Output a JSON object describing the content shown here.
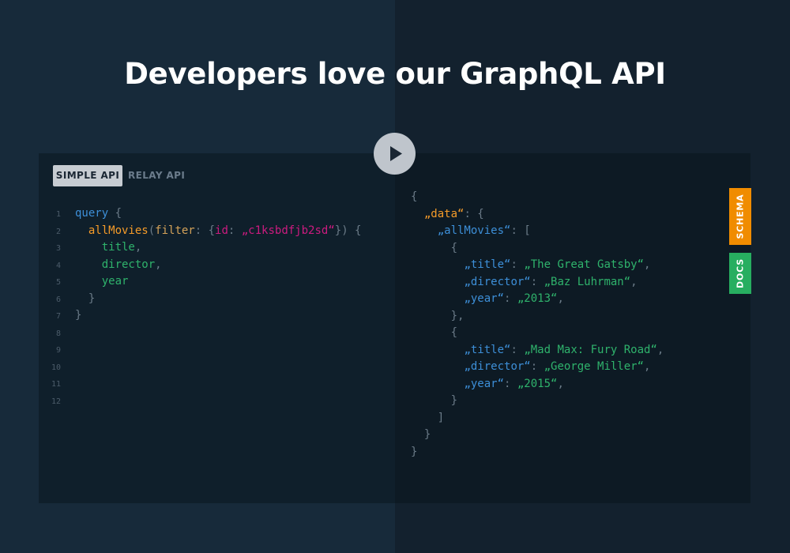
{
  "headline": "Developers love our GraphQL API",
  "tabs": {
    "simple": "SIMPLE API",
    "relay": "RELAY API"
  },
  "side_tabs": {
    "schema": "SCHEMA",
    "docs": "DOCS"
  },
  "colors": {
    "keyword": "#3d8fd8",
    "field": "#f59b29",
    "string_arg": "#cc1b7f",
    "plain_field": "#2fb36c",
    "schema_tab": "#f08c00",
    "docs_tab": "#27ae60"
  },
  "icons": {
    "play": "play-icon"
  },
  "query_editor": {
    "line_numbers": [
      "1",
      "2",
      "3",
      "4",
      "5",
      "6",
      "7",
      "8",
      "9",
      "10",
      "11",
      "12"
    ],
    "lines": [
      [
        {
          "t": "query",
          "c": "kw"
        },
        {
          "t": " {",
          "c": "punc"
        }
      ],
      [
        {
          "t": "  ",
          "c": "punc"
        },
        {
          "t": "allMovies",
          "c": "field"
        },
        {
          "t": "(",
          "c": "punc"
        },
        {
          "t": "filter",
          "c": "attr"
        },
        {
          "t": ": {",
          "c": "punc"
        },
        {
          "t": "id",
          "c": "str"
        },
        {
          "t": ": ",
          "c": "punc"
        },
        {
          "t": "„c1ksbdfjb2sd“",
          "c": "str"
        },
        {
          "t": "}) {",
          "c": "punc"
        }
      ],
      [
        {
          "t": "    title",
          "c": "plain"
        },
        {
          "t": ",",
          "c": "punc"
        }
      ],
      [
        {
          "t": "    director",
          "c": "plain"
        },
        {
          "t": ",",
          "c": "punc"
        }
      ],
      [
        {
          "t": "    year",
          "c": "plain"
        }
      ],
      [
        {
          "t": "  }",
          "c": "punc"
        }
      ],
      [
        {
          "t": "}",
          "c": "punc"
        }
      ],
      [],
      [],
      [],
      [],
      []
    ]
  },
  "result_viewer": {
    "lines": [
      [
        {
          "t": "{",
          "c": "punc"
        }
      ],
      [
        {
          "t": "  ",
          "c": "punc"
        },
        {
          "t": "„data“",
          "c": "field"
        },
        {
          "t": ": {",
          "c": "punc"
        }
      ],
      [
        {
          "t": "    ",
          "c": "punc"
        },
        {
          "t": "„allMovies“",
          "c": "key"
        },
        {
          "t": ": [",
          "c": "punc"
        }
      ],
      [
        {
          "t": "      {",
          "c": "punc"
        }
      ],
      [
        {
          "t": "        ",
          "c": "punc"
        },
        {
          "t": "„title“",
          "c": "key"
        },
        {
          "t": ": ",
          "c": "punc"
        },
        {
          "t": "„The Great Gatsby“",
          "c": "val"
        },
        {
          "t": ",",
          "c": "punc"
        }
      ],
      [
        {
          "t": "        ",
          "c": "punc"
        },
        {
          "t": "„director“",
          "c": "key"
        },
        {
          "t": ": ",
          "c": "punc"
        },
        {
          "t": "„Baz Luhrman“",
          "c": "val"
        },
        {
          "t": ",",
          "c": "punc"
        }
      ],
      [
        {
          "t": "        ",
          "c": "punc"
        },
        {
          "t": "„year“",
          "c": "key"
        },
        {
          "t": ": ",
          "c": "punc"
        },
        {
          "t": "„2013“",
          "c": "val"
        },
        {
          "t": ",",
          "c": "punc"
        }
      ],
      [
        {
          "t": "      },",
          "c": "punc"
        }
      ],
      [
        {
          "t": "      {",
          "c": "punc"
        }
      ],
      [
        {
          "t": "        ",
          "c": "punc"
        },
        {
          "t": "„title“",
          "c": "key"
        },
        {
          "t": ": ",
          "c": "punc"
        },
        {
          "t": "„Mad Max: Fury Road“",
          "c": "val"
        },
        {
          "t": ",",
          "c": "punc"
        }
      ],
      [
        {
          "t": "        ",
          "c": "punc"
        },
        {
          "t": "„director“",
          "c": "key"
        },
        {
          "t": ": ",
          "c": "punc"
        },
        {
          "t": "„George Miller“",
          "c": "val"
        },
        {
          "t": ",",
          "c": "punc"
        }
      ],
      [
        {
          "t": "        ",
          "c": "punc"
        },
        {
          "t": "„year“",
          "c": "key"
        },
        {
          "t": ": ",
          "c": "punc"
        },
        {
          "t": "„2015“",
          "c": "val"
        },
        {
          "t": ",",
          "c": "punc"
        }
      ],
      [
        {
          "t": "      }",
          "c": "punc"
        }
      ],
      [
        {
          "t": "    ]",
          "c": "punc"
        }
      ],
      [
        {
          "t": "  }",
          "c": "punc"
        }
      ],
      [
        {
          "t": "}",
          "c": "punc"
        }
      ]
    ]
  }
}
